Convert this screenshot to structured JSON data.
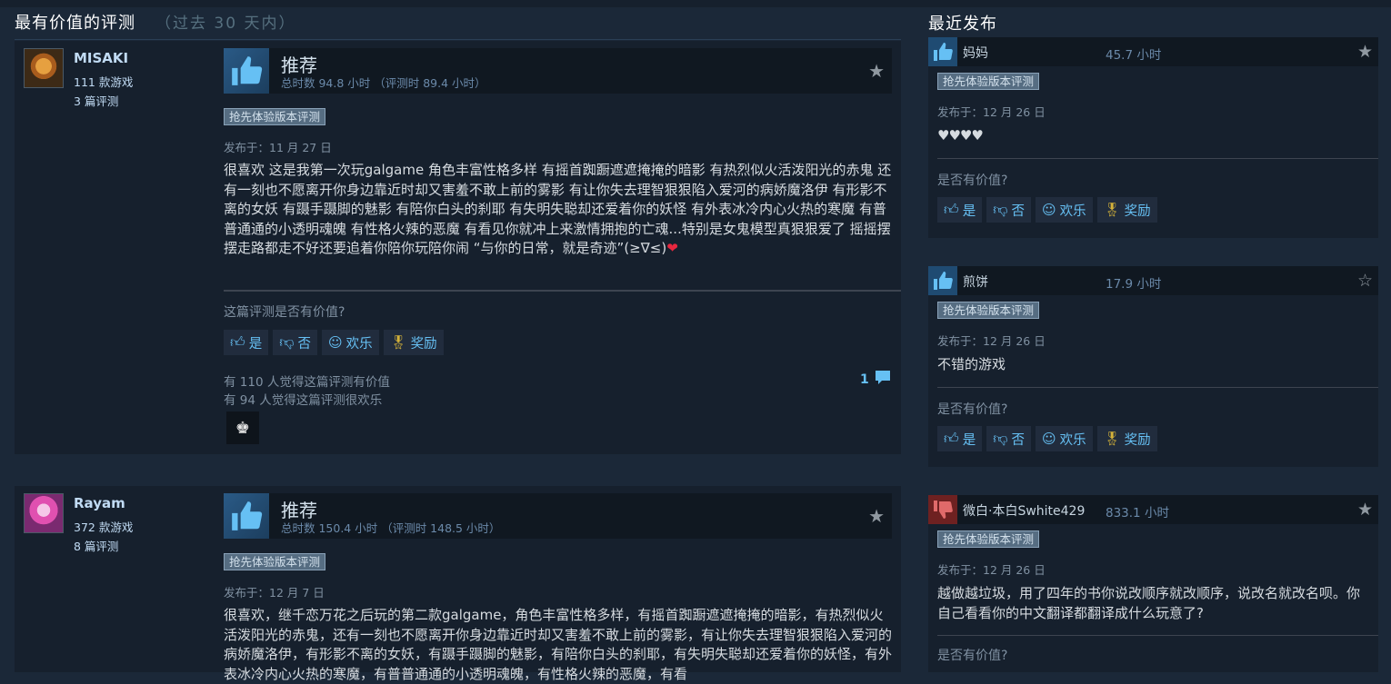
{
  "headers": {
    "most_helpful": "最有价值的评测",
    "period": "（过去 30 天内）",
    "recent": "最近发布"
  },
  "reviews": [
    {
      "username": "MISAKI",
      "games": "111 款游戏",
      "reviews_count": "3 篇评测",
      "verdict": "推荐",
      "hours": "总时数 94.8 小时 （评测时 89.4 小时）",
      "badge": "抢先体验版本评测",
      "posted": "发布于：11 月 27 日",
      "text": "很喜欢 这是我第一次玩galgame 角色丰富性格多样 有摇首踟蹰遮遮掩掩的暗影 有热烈似火活泼阳光的赤鬼 还有一刻也不愿离开你身边靠近时却又害羞不敢上前的雾影 有让你失去理智狠狠陷入爱河的病娇魔洛伊 有形影不离的女妖 有蹑手蹑脚的魅影 有陪你白头的刹耶 有失明失聪却还爱着你的妖怪 有外表冰冷内心火热的寒魔 有普普通通的小透明魂魄 有性格火辣的恶魔 有看见你就冲上来激情拥抱的亡魂...特别是女鬼模型真狠狠爱了 摇摇摆摆走路都走不好还要追着你陪你玩陪你闹 “与你的日常，就是奇迹”(≥∇≤)",
      "heart": "❤",
      "question": "这篇评测是否有价值?",
      "helpful": "有 110 人觉得这篇评测有价值",
      "funny": "有 94 人觉得这篇评测很欢乐",
      "comments": "1"
    },
    {
      "username": "Rayam",
      "games": "372 款游戏",
      "reviews_count": "8 篇评测",
      "verdict": "推荐",
      "hours": "总时数 150.4 小时 （评测时 148.5 小时）",
      "badge": "抢先体验版本评测",
      "posted": "发布于：12 月 7 日",
      "text": "很喜欢，继千恋万花之后玩的第二款galgame，角色丰富性格多样，有摇首踟蹰遮遮掩掩的暗影，有热烈似火活泼阳光的赤鬼，还有一刻也不愿离开你身边靠近时却又害羞不敢上前的雾影，有让你失去理智狠狠陷入爱河的病娇魔洛伊，有形影不离的女妖，有蹑手蹑脚的魅影，有陪你白头的刹耶，有失明失聪却还爱着你的妖怪，有外表冰冷内心火热的寒魔，有普普通通的小透明魂魄，有性格火辣的恶魔，有看"
    }
  ],
  "recent": [
    {
      "name": "妈妈",
      "hours": "45.7 小时",
      "badge": "抢先体验版本评测",
      "posted": "发布于：12 月 26 日",
      "text": "♥♥♥♥",
      "question": "是否有价值?"
    },
    {
      "name": "煎饼",
      "hours": "17.9 小时",
      "badge": "抢先体验版本评测",
      "posted": "发布于：12 月 26 日",
      "text": "不错的游戏",
      "question": "是否有价值?"
    },
    {
      "name": "微白·本白Swhite429",
      "hours": "833.1 小时",
      "badge": "抢先体验版本评测",
      "posted": "发布于：12 月 26 日",
      "text": "越做越垃圾，用了四年的书你说改顺序就改顺序，说改名就改名呗。你自己看看你的中文翻译都翻译成什么玩意了?",
      "question": "是否有价值?"
    }
  ],
  "buttons": {
    "yes": "是",
    "no": "否",
    "funny": "欢乐",
    "award": "奖励"
  },
  "icons": {
    "thumb_up": "thumbs-up-icon",
    "thumb_down": "thumbs-down-icon",
    "star": "star-icon",
    "smile": "smiley-icon",
    "medal": "award-medal-icon",
    "comment": "comment-bubble-icon"
  },
  "colors": {
    "background": "#1b2838",
    "panel": "#16202d",
    "link_blue": "#66c0f4",
    "negative_red": "#6e2121"
  }
}
